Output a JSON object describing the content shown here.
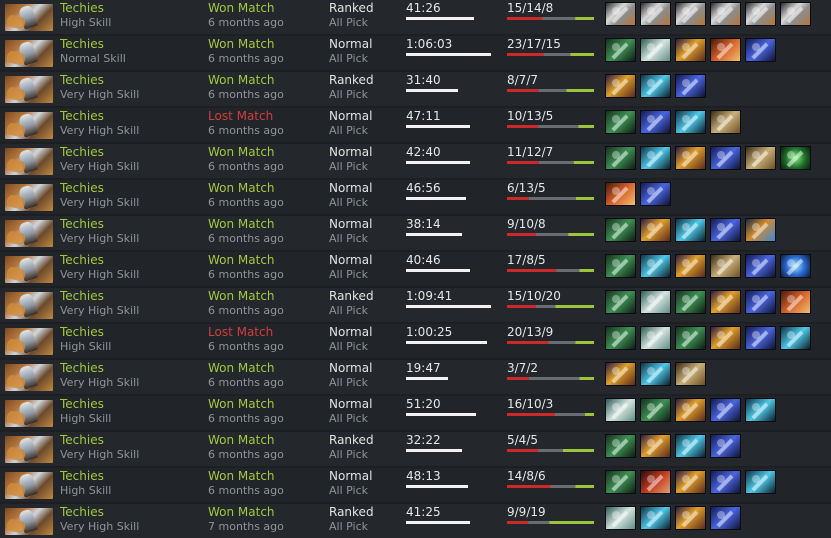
{
  "colors": {
    "win": "#a4c740",
    "loss": "#cf3f3b",
    "kda_kills": "#cc2a2a",
    "kda_deaths": "#6a6d70",
    "kda_assists": "#9ec43d",
    "duration_bar": "#f2f2f2"
  },
  "item_styles": {
    "axe-item-icon": "linear-gradient(135deg,#2a2a2a 0%,#d9d9d9 38%,#8c8c8c 60%,#b8743a 100%)",
    "green-wand-item-icon": "linear-gradient(135deg,#15311f 0%,#3f9155 50%,#0e1c12 100%)",
    "wind-swirl-item-icon": "linear-gradient(135deg,#2c5b55 0%,#d5e4df 50%,#5f8d83 100%)",
    "fire-staff-item-icon": "linear-gradient(135deg,#2d1840 0%,#e0a02c 45%,#5a2a1c 100%)",
    "fire-wing-item-icon": "linear-gradient(135deg,#4a1a0a 0%,#d8622a 50%,#f0c070 100%)",
    "blue-scepter-item-icon": "linear-gradient(135deg,#141a55 0%,#4a66e0 50%,#0e1233 100%)",
    "blue-orb-item-icon": "linear-gradient(135deg,#0e3346 0%,#4fc8e8 50%,#0a1e2a 100%)",
    "scroll-item-icon": "linear-gradient(135deg,#3a2a14 0%,#c9b07a 50%,#6c5026 100%)",
    "green-gem-item-icon": "radial-gradient(circle,#7df07a 0%,#1f6b2a 55%,#0a1f0d 100%)",
    "orb-staff-item-icon": "linear-gradient(135deg,#1c2a44 0%,#d08a2e 45%,#3d88d8 100%)",
    "blue-swirl-item-icon": "radial-gradient(circle,#9fe2ff 0%,#2a6ad0 50%,#0c1b3a 100%)",
    "red-dagger-item-icon": "linear-gradient(135deg,#2e0d0a 0%,#c23a1e 50%,#e0a070 100%)"
  },
  "matches": [
    {
      "hero": "Techies",
      "skill": "High Skill",
      "result": "Won Match",
      "result_type": "win",
      "when": "6 months ago",
      "lobby": "Ranked",
      "mode": "All Pick",
      "duration": "41:26",
      "duration_fraction": 0.72,
      "kda": "15/14/8",
      "kills": 15,
      "deaths": 14,
      "assists": 8,
      "items": [
        "axe-item-icon",
        "axe-item-icon",
        "axe-item-icon",
        "axe-item-icon",
        "axe-item-icon",
        "axe-item-icon"
      ]
    },
    {
      "hero": "Techies",
      "skill": "Normal Skill",
      "result": "Won Match",
      "result_type": "win",
      "when": "6 months ago",
      "lobby": "Normal",
      "mode": "All Pick",
      "duration": "1:06:03",
      "duration_fraction": 0.9,
      "kda": "23/17/15",
      "kills": 23,
      "deaths": 17,
      "assists": 15,
      "items": [
        "green-wand-item-icon",
        "wind-swirl-item-icon",
        "fire-staff-item-icon",
        "fire-wing-item-icon",
        "blue-scepter-item-icon"
      ]
    },
    {
      "hero": "Techies",
      "skill": "Very High Skill",
      "result": "Won Match",
      "result_type": "win",
      "when": "6 months ago",
      "lobby": "Ranked",
      "mode": "All Pick",
      "duration": "31:40",
      "duration_fraction": 0.55,
      "kda": "8/7/7",
      "kills": 8,
      "deaths": 7,
      "assists": 7,
      "items": [
        "fire-staff-item-icon",
        "blue-orb-item-icon",
        "blue-scepter-item-icon"
      ]
    },
    {
      "hero": "Techies",
      "skill": "Very High Skill",
      "result": "Lost Match",
      "result_type": "loss",
      "when": "6 months ago",
      "lobby": "Normal",
      "mode": "All Pick",
      "duration": "47:11",
      "duration_fraction": 0.68,
      "kda": "10/13/5",
      "kills": 10,
      "deaths": 13,
      "assists": 5,
      "items": [
        "green-wand-item-icon",
        "blue-scepter-item-icon",
        "blue-orb-item-icon",
        "scroll-item-icon"
      ]
    },
    {
      "hero": "Techies",
      "skill": "Very High Skill",
      "result": "Won Match",
      "result_type": "win",
      "when": "6 months ago",
      "lobby": "Normal",
      "mode": "All Pick",
      "duration": "42:40",
      "duration_fraction": 0.68,
      "kda": "11/12/7",
      "kills": 11,
      "deaths": 12,
      "assists": 7,
      "items": [
        "green-wand-item-icon",
        "blue-orb-item-icon",
        "fire-staff-item-icon",
        "blue-scepter-item-icon",
        "scroll-item-icon",
        "green-gem-item-icon"
      ]
    },
    {
      "hero": "Techies",
      "skill": "Very High Skill",
      "result": "Won Match",
      "result_type": "win",
      "when": "6 months ago",
      "lobby": "Normal",
      "mode": "All Pick",
      "duration": "46:56",
      "duration_fraction": 0.64,
      "kda": "6/13/5",
      "kills": 6,
      "deaths": 13,
      "assists": 5,
      "items": [
        "fire-wing-item-icon",
        "blue-scepter-item-icon"
      ]
    },
    {
      "hero": "Techies",
      "skill": "Very High Skill",
      "result": "Won Match",
      "result_type": "win",
      "when": "6 months ago",
      "lobby": "Normal",
      "mode": "All Pick",
      "duration": "38:14",
      "duration_fraction": 0.6,
      "kda": "9/10/8",
      "kills": 9,
      "deaths": 10,
      "assists": 8,
      "items": [
        "green-wand-item-icon",
        "fire-staff-item-icon",
        "blue-orb-item-icon",
        "blue-scepter-item-icon",
        "orb-staff-item-icon"
      ]
    },
    {
      "hero": "Techies",
      "skill": "Very High Skill",
      "result": "Won Match",
      "result_type": "win",
      "when": "6 months ago",
      "lobby": "Normal",
      "mode": "All Pick",
      "duration": "40:46",
      "duration_fraction": 0.68,
      "kda": "17/8/5",
      "kills": 17,
      "deaths": 8,
      "assists": 5,
      "items": [
        "green-wand-item-icon",
        "blue-orb-item-icon",
        "fire-staff-item-icon",
        "scroll-item-icon",
        "blue-scepter-item-icon",
        "blue-swirl-item-icon"
      ]
    },
    {
      "hero": "Techies",
      "skill": "Very High Skill",
      "result": "Won Match",
      "result_type": "win",
      "when": "6 months ago",
      "lobby": "Ranked",
      "mode": "All Pick",
      "duration": "1:09:41",
      "duration_fraction": 0.9,
      "kda": "15/10/20",
      "kills": 15,
      "deaths": 10,
      "assists": 20,
      "items": [
        "green-wand-item-icon",
        "wind-swirl-item-icon",
        "green-wand-item-icon",
        "fire-staff-item-icon",
        "blue-scepter-item-icon",
        "fire-wing-item-icon"
      ]
    },
    {
      "hero": "Techies",
      "skill": "High Skill",
      "result": "Lost Match",
      "result_type": "loss",
      "when": "6 months ago",
      "lobby": "Normal",
      "mode": "All Pick",
      "duration": "1:00:25",
      "duration_fraction": 0.86,
      "kda": "20/13/9",
      "kills": 20,
      "deaths": 13,
      "assists": 9,
      "items": [
        "green-wand-item-icon",
        "wind-swirl-item-icon",
        "green-wand-item-icon",
        "fire-staff-item-icon",
        "blue-scepter-item-icon",
        "blue-orb-item-icon"
      ]
    },
    {
      "hero": "Techies",
      "skill": "Very High Skill",
      "result": "Won Match",
      "result_type": "win",
      "when": "6 months ago",
      "lobby": "Normal",
      "mode": "All Pick",
      "duration": "19:47",
      "duration_fraction": 0.45,
      "kda": "3/7/2",
      "kills": 3,
      "deaths": 7,
      "assists": 2,
      "items": [
        "fire-staff-item-icon",
        "blue-orb-item-icon",
        "scroll-item-icon"
      ]
    },
    {
      "hero": "Techies",
      "skill": "High Skill",
      "result": "Won Match",
      "result_type": "win",
      "when": "6 months ago",
      "lobby": "Normal",
      "mode": "All Pick",
      "duration": "51:20",
      "duration_fraction": 0.74,
      "kda": "16/10/3",
      "kills": 16,
      "deaths": 10,
      "assists": 3,
      "items": [
        "wind-swirl-item-icon",
        "green-wand-item-icon",
        "fire-staff-item-icon",
        "blue-scepter-item-icon",
        "blue-orb-item-icon"
      ]
    },
    {
      "hero": "Techies",
      "skill": "Very High Skill",
      "result": "Won Match",
      "result_type": "win",
      "when": "6 months ago",
      "lobby": "Ranked",
      "mode": "All Pick",
      "duration": "32:22",
      "duration_fraction": 0.6,
      "kda": "5/4/5",
      "kills": 5,
      "deaths": 4,
      "assists": 5,
      "items": [
        "green-wand-item-icon",
        "fire-staff-item-icon",
        "blue-orb-item-icon",
        "blue-scepter-item-icon"
      ]
    },
    {
      "hero": "Techies",
      "skill": "High Skill",
      "result": "Won Match",
      "result_type": "win",
      "when": "6 months ago",
      "lobby": "Normal",
      "mode": "All Pick",
      "duration": "48:13",
      "duration_fraction": 0.66,
      "kda": "14/8/6",
      "kills": 14,
      "deaths": 8,
      "assists": 6,
      "items": [
        "green-wand-item-icon",
        "red-dagger-item-icon",
        "fire-staff-item-icon",
        "blue-scepter-item-icon",
        "blue-orb-item-icon"
      ]
    },
    {
      "hero": "Techies",
      "skill": "Very High Skill",
      "result": "Won Match",
      "result_type": "win",
      "when": "7 months ago",
      "lobby": "Ranked",
      "mode": "All Pick",
      "duration": "41:25",
      "duration_fraction": 0.68,
      "kda": "9/9/19",
      "kills": 9,
      "deaths": 9,
      "assists": 19,
      "items": [
        "wind-swirl-item-icon",
        "blue-orb-item-icon",
        "fire-staff-item-icon",
        "blue-scepter-item-icon"
      ]
    }
  ]
}
